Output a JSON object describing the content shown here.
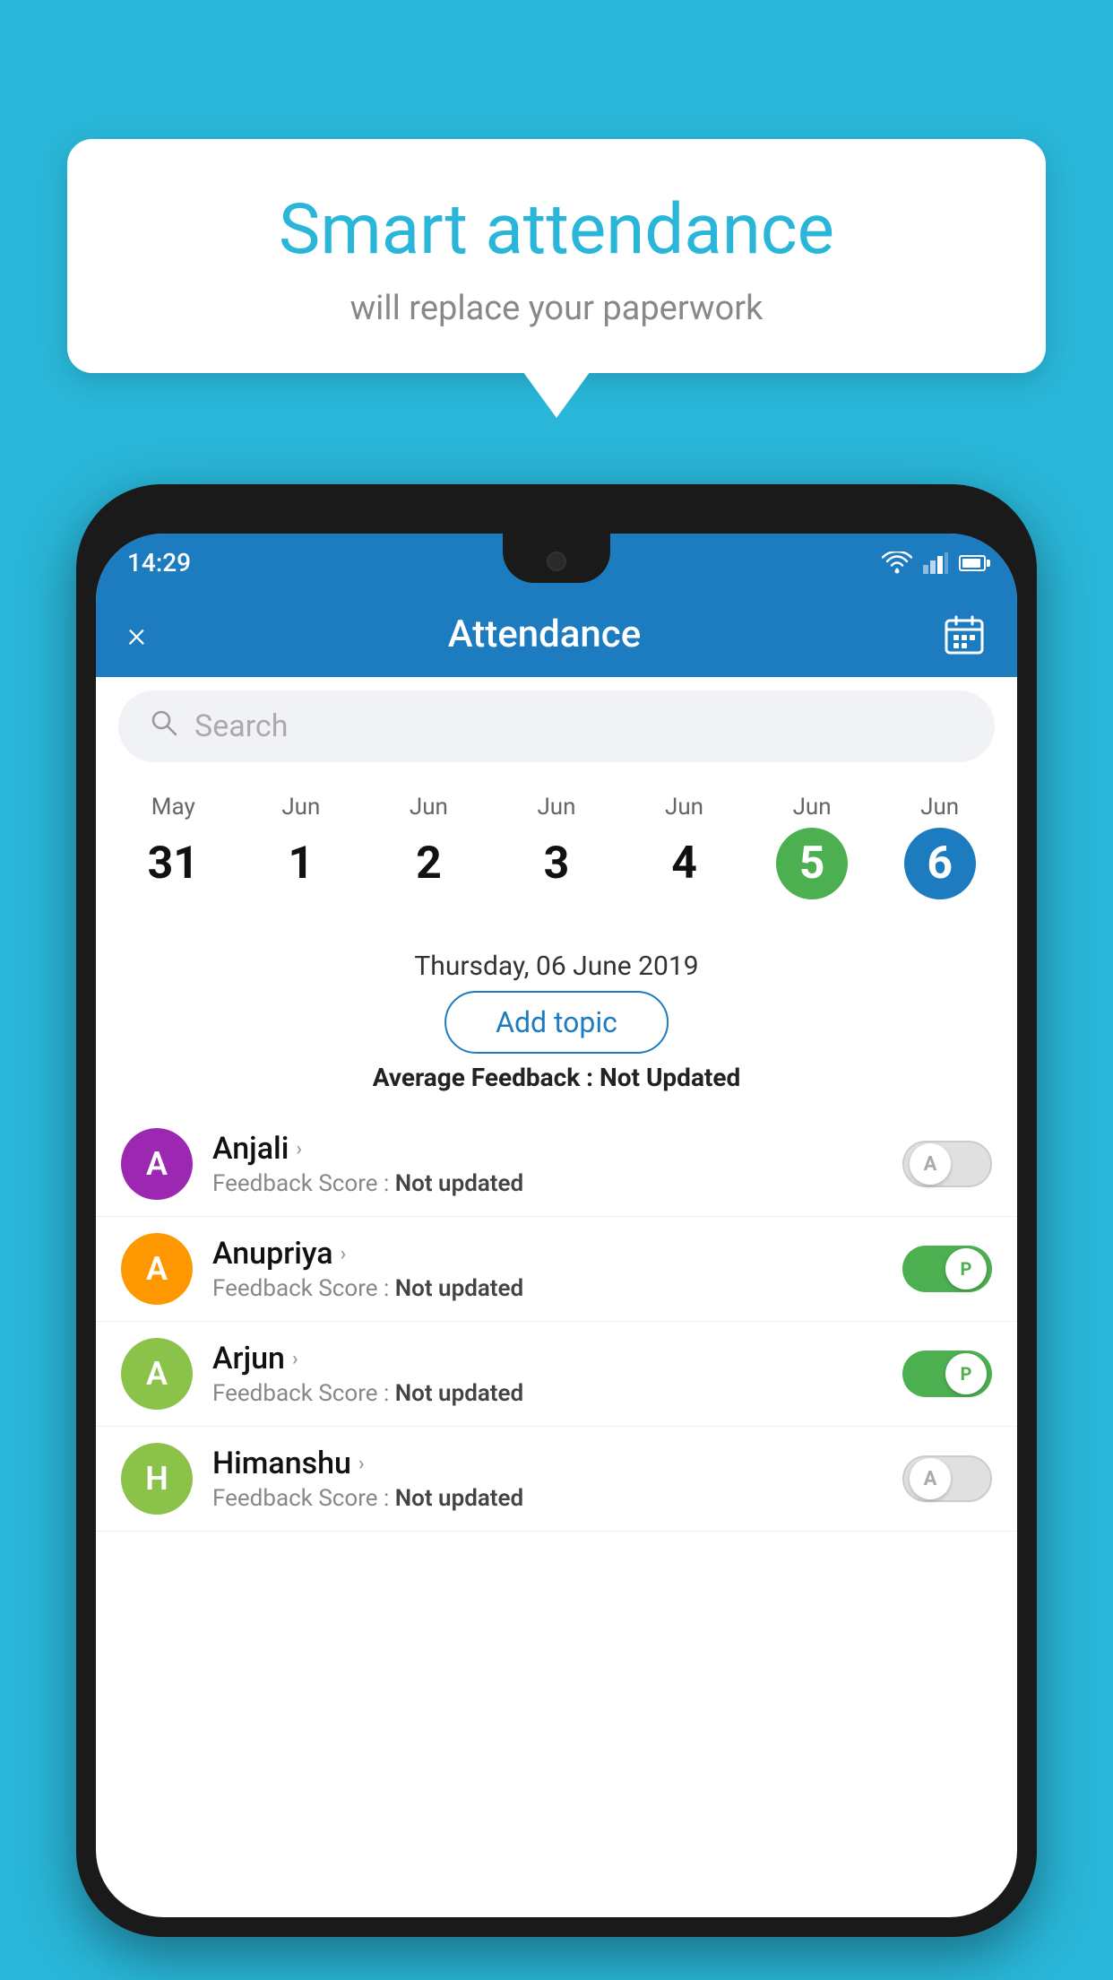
{
  "background_color": "#29b6d8",
  "bubble": {
    "title": "Smart attendance",
    "subtitle": "will replace your paperwork"
  },
  "status_bar": {
    "time": "14:29"
  },
  "header": {
    "title": "Attendance",
    "close_label": "×",
    "calendar_label": "📅"
  },
  "search": {
    "placeholder": "Search"
  },
  "calendar": {
    "days": [
      {
        "month": "May",
        "num": "31",
        "state": "normal"
      },
      {
        "month": "Jun",
        "num": "1",
        "state": "normal"
      },
      {
        "month": "Jun",
        "num": "2",
        "state": "normal"
      },
      {
        "month": "Jun",
        "num": "3",
        "state": "normal"
      },
      {
        "month": "Jun",
        "num": "4",
        "state": "normal"
      },
      {
        "month": "Jun",
        "num": "5",
        "state": "today"
      },
      {
        "month": "Jun",
        "num": "6",
        "state": "selected"
      }
    ]
  },
  "selected_date": "Thursday, 06 June 2019",
  "add_topic_label": "Add topic",
  "avg_feedback_label": "Average Feedback : ",
  "avg_feedback_value": "Not Updated",
  "students": [
    {
      "name": "Anjali",
      "avatar_letter": "A",
      "avatar_color": "#9c27b0",
      "feedback_label": "Feedback Score : ",
      "feedback_value": "Not updated",
      "toggle_state": "off",
      "toggle_label": "A"
    },
    {
      "name": "Anupriya",
      "avatar_letter": "A",
      "avatar_color": "#ff9800",
      "feedback_label": "Feedback Score : ",
      "feedback_value": "Not updated",
      "toggle_state": "on",
      "toggle_label": "P"
    },
    {
      "name": "Arjun",
      "avatar_letter": "A",
      "avatar_color": "#8bc34a",
      "feedback_label": "Feedback Score : ",
      "feedback_value": "Not updated",
      "toggle_state": "on",
      "toggle_label": "P"
    },
    {
      "name": "Himanshu",
      "avatar_letter": "H",
      "avatar_color": "#8bc34a",
      "feedback_label": "Feedback Score : ",
      "feedback_value": "Not updated",
      "toggle_state": "off",
      "toggle_label": "A"
    }
  ]
}
